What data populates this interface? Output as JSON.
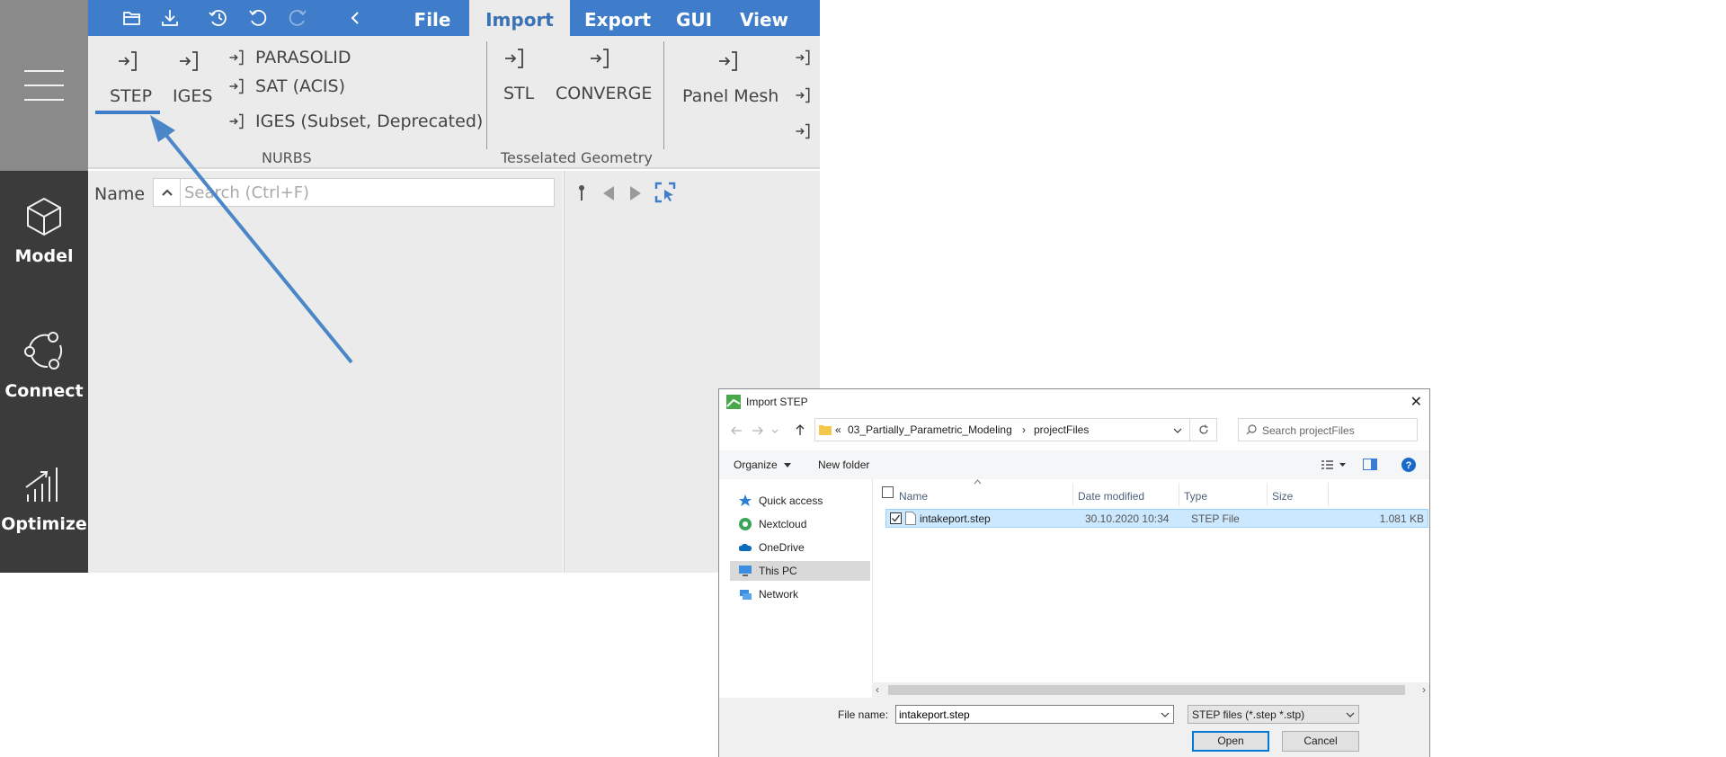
{
  "toolbar": {
    "tabs": [
      "File",
      "Import",
      "Export",
      "GUI",
      "View"
    ],
    "active_tab": "Import"
  },
  "sidebar": {
    "items": [
      {
        "label": "Model"
      },
      {
        "label": "Connect"
      },
      {
        "label": "Optimize"
      }
    ]
  },
  "ribbon": {
    "nurbs": {
      "step": "STEP",
      "iges": "IGES",
      "parasolid": "PARASOLID",
      "sat": "SAT (ACIS)",
      "iges_subset": "IGES (Subset, Deprecated)",
      "group_label": "NURBS"
    },
    "tesselated": {
      "stl": "STL",
      "converge": "CONVERGE",
      "group_label": "Tesselated Geometry"
    },
    "panel_mesh": "Panel Mesh"
  },
  "tree_panel": {
    "name_label": "Name",
    "search_placeholder": "Search (Ctrl+F)"
  },
  "dialog": {
    "title": "Import STEP",
    "close": "✕",
    "breadcrumb": {
      "prefix": "«",
      "folder": "03_Partially_Parametric_Modeling",
      "sep": "›",
      "subfolder": "projectFiles"
    },
    "search_placeholder": "Search projectFiles",
    "organize": "Organize",
    "new_folder": "New folder",
    "nav": [
      {
        "label": "Quick access",
        "icon": "star-icon"
      },
      {
        "label": "Nextcloud",
        "icon": "nextcloud-icon"
      },
      {
        "label": "OneDrive",
        "icon": "cloud-icon"
      },
      {
        "label": "This PC",
        "icon": "computer-icon"
      },
      {
        "label": "Network",
        "icon": "network-icon"
      }
    ],
    "selected_nav": "This PC",
    "columns": [
      "Name",
      "Date modified",
      "Type",
      "Size"
    ],
    "files": [
      {
        "name": "intakeport.step",
        "date": "30.10.2020 10:34",
        "type": "STEP File",
        "size": "1.081 KB"
      }
    ],
    "file_name_label": "File name:",
    "file_name_value": "intakeport.step",
    "filter": "STEP files (*.step *.stp)",
    "open": "Open",
    "cancel": "Cancel"
  },
  "colors": {
    "toolbar_blue": "#3f7cc9",
    "sidebar_dark": "#3b3b3b",
    "annotation_arrow": "#4a86c8",
    "selection": "#cce8ff"
  }
}
